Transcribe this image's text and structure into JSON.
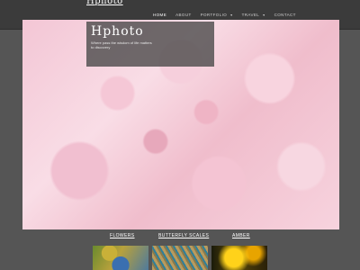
{
  "site": {
    "logo": "Hphoto"
  },
  "nav": {
    "items": [
      {
        "label": "HOME",
        "active": true,
        "dropdown": false
      },
      {
        "label": "ABOUT",
        "active": false,
        "dropdown": false
      },
      {
        "label": "PORTFOLIO",
        "active": false,
        "dropdown": true
      },
      {
        "label": "TRAVEL",
        "active": false,
        "dropdown": true
      },
      {
        "label": "CONTACT",
        "active": false,
        "dropdown": false
      }
    ]
  },
  "hero": {
    "title": "Hphoto",
    "tagline": "Where pass the wisdom of life matters to discovery"
  },
  "gallery": {
    "items": [
      {
        "label": "FLOWERS"
      },
      {
        "label": "BUTTERFLY SCALES"
      },
      {
        "label": "AMBER"
      }
    ]
  },
  "colors": {
    "page_background": "#555555",
    "header_background": "#3b3b3b",
    "text": "#ffffff"
  }
}
